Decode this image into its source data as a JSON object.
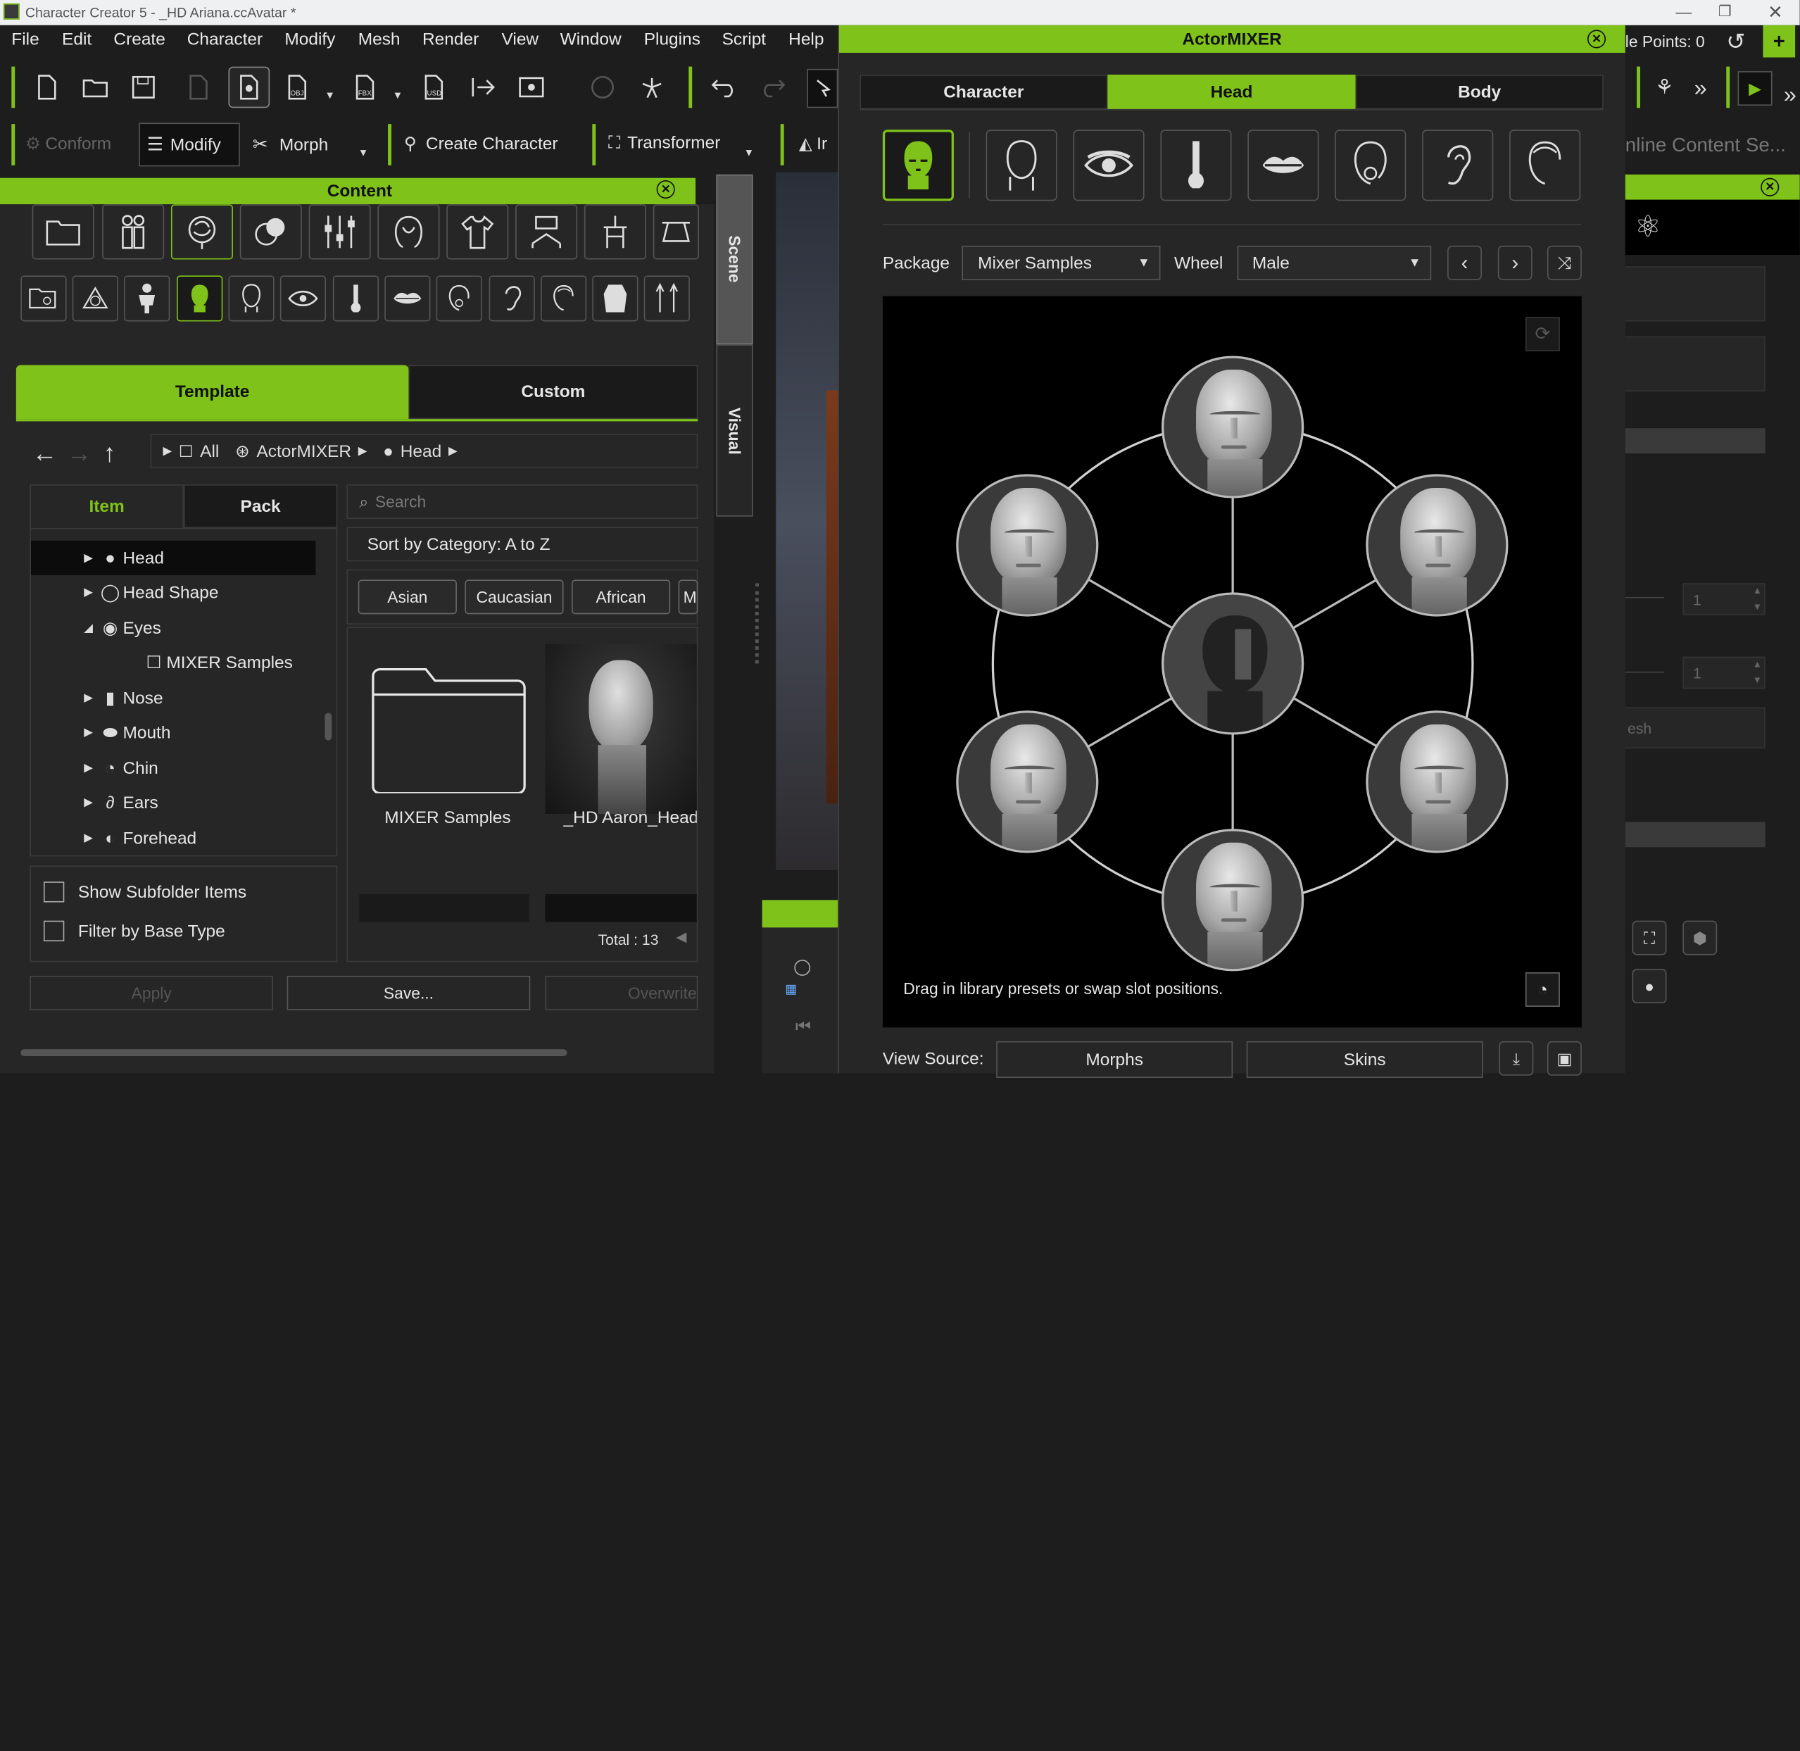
{
  "window": {
    "title": "Character Creator 5 - _HD Ariana.ccAvatar *"
  },
  "menu": [
    "File",
    "Edit",
    "Create",
    "Character",
    "Modify",
    "Mesh",
    "Render",
    "View",
    "Window",
    "Plugins",
    "Script",
    "Help"
  ],
  "toolbar2": {
    "conform": "Conform",
    "modify": "Modify",
    "morph": "Morph",
    "create_character": "Create Character",
    "transformer": "Transformer",
    "clipped": "Ir"
  },
  "content_panel": {
    "title": "Content",
    "side_tabs": {
      "scene": "Scene",
      "visual": "Visual"
    },
    "tabs": {
      "template": "Template",
      "custom": "Custom"
    },
    "breadcrumb": [
      "All",
      "ActorMIXER",
      "Head"
    ],
    "subtabs": {
      "item": "Item",
      "pack": "Pack"
    },
    "search_placeholder": "Search",
    "sort": "Sort by Category: A to Z",
    "filters": [
      "Asian",
      "Caucasian",
      "African",
      "M"
    ],
    "tree": [
      {
        "label": "Head",
        "arrow": "▶"
      },
      {
        "label": "Head Shape",
        "arrow": "▶"
      },
      {
        "label": "Eyes",
        "arrow": "◢"
      },
      {
        "label": "MIXER Samples",
        "arrow": ""
      },
      {
        "label": "Nose",
        "arrow": "▶"
      },
      {
        "label": "Mouth",
        "arrow": "▶"
      },
      {
        "label": "Chin",
        "arrow": "▶"
      },
      {
        "label": "Ears",
        "arrow": "▶"
      },
      {
        "label": "Forehead",
        "arrow": "▶"
      }
    ],
    "checkboxes": {
      "show_subfolder": "Show Subfolder Items",
      "filter_base": "Filter by Base Type"
    },
    "grid": [
      {
        "label": "MIXER Samples"
      },
      {
        "label": "_HD Aaron_Head"
      }
    ],
    "total": "Total : 13",
    "buttons": {
      "apply": "Apply",
      "save": "Save...",
      "overwrite": "Overwrite"
    }
  },
  "right_top": {
    "points": "le Points: 0",
    "online": "nline Content Se...",
    "mesh": "esh",
    "val1": "1",
    "val2": "1"
  },
  "actormixer": {
    "title": "ActorMIXER",
    "tabs": {
      "character": "Character",
      "head": "Head",
      "body": "Body"
    },
    "package_label": "Package",
    "package_value": "Mixer Samples",
    "wheel_label": "Wheel",
    "wheel_value": "Male",
    "hint": "Drag in library presets or swap slot positions.",
    "view_source_label": "View Source:",
    "morphs": "Morphs",
    "skins": "Skins"
  },
  "colors": {
    "accent": "#7ec21a",
    "bg": "#1d1d1d",
    "panel": "#262626"
  }
}
